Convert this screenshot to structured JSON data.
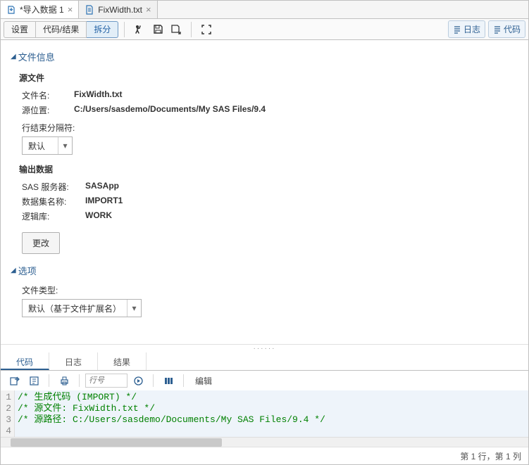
{
  "topTabs": [
    {
      "label": "*导入数据 1",
      "icon": "import"
    },
    {
      "label": "FixWidth.txt",
      "icon": "file"
    }
  ],
  "segButtons": {
    "settings": "设置",
    "codeResult": "代码/结果",
    "split": "拆分"
  },
  "rightPills": {
    "log": "日志",
    "code": "代码"
  },
  "sections": {
    "fileInfo": "文件信息",
    "options": "选项"
  },
  "sourceFile": {
    "header": "源文件",
    "filenameLabel": "文件名:",
    "filename": "FixWidth.txt",
    "pathLabel": "源位置:",
    "path": "C:/Users/sasdemo/Documents/My SAS Files/9.4",
    "delimLabel": "行结束分隔符:",
    "delimValue": "默认"
  },
  "outputData": {
    "header": "输出数据",
    "serverLabel": "SAS 服务器:",
    "server": "SASApp",
    "dsLabel": "数据集名称:",
    "ds": "IMPORT1",
    "libLabel": "逻辑库:",
    "lib": "WORK",
    "changeBtn": "更改"
  },
  "options": {
    "filetypeLabel": "文件类型:",
    "filetypeValue": "默认（基于文件扩展名）"
  },
  "bottomTabs": {
    "code": "代码",
    "log": "日志",
    "result": "结果"
  },
  "codeToolbar": {
    "lineplaceholder": "行号",
    "edit": "编辑"
  },
  "codeLines": [
    "/* 生成代码 (IMPORT) */",
    "/* 源文件: FixWidth.txt */",
    "/* 源路径: C:/Users/sasdemo/Documents/My SAS Files/9.4 */",
    ""
  ],
  "status": "第 1 行，第 1 列"
}
